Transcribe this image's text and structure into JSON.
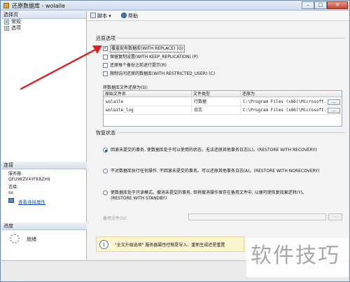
{
  "window": {
    "title": "还原数据库 - wolaile",
    "buttons": {
      "minimize": "–",
      "maximize": "□",
      "close": "✕"
    }
  },
  "left": {
    "select_page_title": "选择页",
    "pages": [
      {
        "label": "常规"
      },
      {
        "label": "选项"
      }
    ],
    "connection_title": "连接",
    "server_label": "服务器:",
    "server_value": "QFU9KZV4YFK8ZH9",
    "connection_label": "连接:",
    "connection_value": "sa",
    "view_connection_link": "查看连接属性",
    "progress_title": "进度",
    "progress_status": "就绪"
  },
  "toolbar": {
    "script_label": "脚本",
    "dropdown_glyph": "▾",
    "help_label": "帮助"
  },
  "restore_options": {
    "title": "还原选项",
    "items": [
      {
        "label": "覆盖现有数据库(WITH REPLACE) (O)",
        "checked": true
      },
      {
        "label": "保留复制设置(WITH KEEP_REPLICATION) (P)",
        "checked": false
      },
      {
        "label": "还原每个备份之前进行提示(R)",
        "checked": false
      },
      {
        "label": "限制访问还原的数据库(WITH RESTRICTED_USER) (C)",
        "checked": false
      }
    ]
  },
  "restore_files": {
    "label": "将数据库文件还原为(S):",
    "columns": [
      "原始文件名",
      "文件类型",
      "还原为"
    ],
    "rows": [
      {
        "name": "wolaile",
        "type": "行数据",
        "path": "C:\\Program Files (x86)\\Microsoft...",
        "button": "..."
      },
      {
        "name": "wolaile_log",
        "type": "日志",
        "path": "C:\\Program Files (x86)\\Microsoft...",
        "button": "..."
      }
    ]
  },
  "recovery_state": {
    "title": "恢复状态",
    "options": [
      {
        "line1": "回滚未提交的事务, 使数据库处于可以使用的状态。无法还原其他事务日志(L)。(RESTORE WITH RECOVERY)",
        "line2": "",
        "checked": true
      },
      {
        "line1": "不对数据库执行任何操作, 不回滚未提交的事务。可以还原其他事务日志(A)。(RESTORE WITH NORECOVERY)",
        "line2": "",
        "checked": false
      },
      {
        "line1": "使数据库处于只读模式。撤消未提交的事务, 但将撤消操作保存在备用文件中, 以便可使恢复效果逆转(Y)。",
        "line2": "(RESTORE WITH STANDBY)",
        "checked": false
      }
    ],
    "standby_label": "备用文件(S):",
    "standby_value": "",
    "standby_button": "..."
  },
  "info_bar": {
    "icon": "i",
    "text": "\"全文升级选项\" 服务器属性控制是导入、重新生成还是重置"
  },
  "watermark": {
    "text": "软件技巧"
  },
  "colors": {
    "arrow": "#e02020",
    "link": "#1a55b0",
    "info_bg": "#fbf5cf"
  }
}
